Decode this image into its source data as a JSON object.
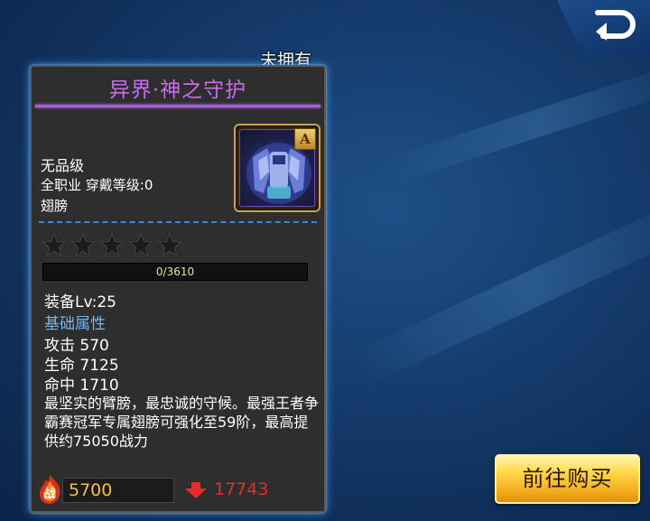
{
  "item": {
    "owned_status": "未拥有",
    "name": "异界·神之守护",
    "quality": "无品级",
    "job_level": "全职业 穿戴等级:0",
    "slot": "翅膀",
    "grade": "A",
    "stars_total": 5,
    "stars_filled": 0,
    "exp_text": "0/3610",
    "exp_fraction": 0,
    "equip_level": "装备Lv:25",
    "attr_header": "基础属性",
    "attack": "攻击  570",
    "hp": "生命  7125",
    "hit": "命中  1710",
    "description": "最坚实的臂膀，最忠诚的守候。最强王者争霸赛冠军专属翅膀可强化至59阶，最高提供约75050战力"
  },
  "power": {
    "icon_label": "战",
    "value": "5700",
    "diff": "17743"
  },
  "buttons": {
    "buy": "前往购买"
  },
  "colors": {
    "title": "#c86cf0",
    "attr_header": "#6fb6f2",
    "power_value": "#f2c14a",
    "diff_value": "#e62b2b"
  },
  "icons": {
    "back": "back-arrow-icon",
    "item": "wings-armor-icon",
    "power": "battle-power-icon",
    "diff": "down-arrow-icon"
  }
}
